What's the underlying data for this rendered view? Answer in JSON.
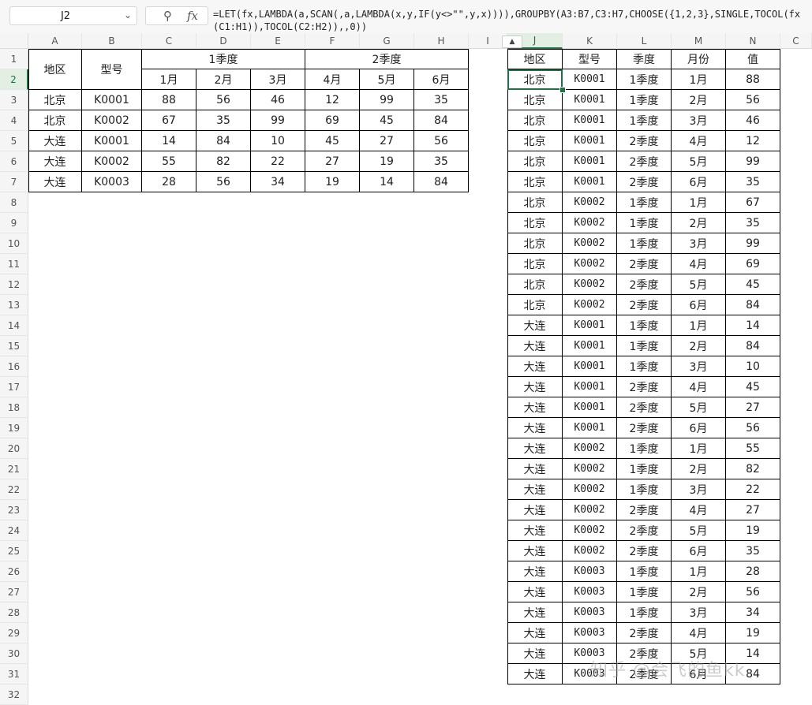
{
  "formula_bar": {
    "name_box": "J2",
    "formula": "=LET(fx,LAMBDA(a,SCAN(,a,LAMBDA(x,y,IF(y<>\"\",y,x)))),GROUPBY(A3:B7,C3:H7,CHOOSE({1,2,3},SINGLE,TOCOL(fx(C1:H1)),TOCOL(C2:H2)),,0))"
  },
  "columns": [
    "A",
    "B",
    "C",
    "D",
    "E",
    "F",
    "G",
    "H",
    "I",
    "J",
    "K",
    "L",
    "M",
    "N",
    "C"
  ],
  "selected_column": "J",
  "selected_row": "2",
  "rows": [
    "1",
    "2",
    "3",
    "4",
    "5",
    "6",
    "7",
    "8",
    "9",
    "10",
    "11",
    "12",
    "13",
    "14",
    "15",
    "16",
    "17",
    "18",
    "19",
    "20",
    "21",
    "22",
    "23",
    "24",
    "25",
    "26",
    "27",
    "28",
    "29",
    "30",
    "31",
    "32"
  ],
  "source": {
    "h_region": "地区",
    "h_model": "型号",
    "h_q1": "1季度",
    "h_q2": "2季度",
    "months": [
      "1月",
      "2月",
      "3月",
      "4月",
      "5月",
      "6月"
    ],
    "rows": [
      [
        "北京",
        "K0001",
        "88",
        "56",
        "46",
        "12",
        "99",
        "35"
      ],
      [
        "北京",
        "K0002",
        "67",
        "35",
        "99",
        "69",
        "45",
        "84"
      ],
      [
        "大连",
        "K0001",
        "14",
        "84",
        "10",
        "45",
        "27",
        "56"
      ],
      [
        "大连",
        "K0002",
        "55",
        "82",
        "22",
        "27",
        "19",
        "35"
      ],
      [
        "大连",
        "K0003",
        "28",
        "56",
        "34",
        "19",
        "14",
        "84"
      ]
    ]
  },
  "output": {
    "headers": [
      "地区",
      "型号",
      "季度",
      "月份",
      "值"
    ],
    "rows": [
      [
        "北京",
        "K0001",
        "1季度",
        "1月",
        "88"
      ],
      [
        "北京",
        "K0001",
        "1季度",
        "2月",
        "56"
      ],
      [
        "北京",
        "K0001",
        "1季度",
        "3月",
        "46"
      ],
      [
        "北京",
        "K0001",
        "2季度",
        "4月",
        "12"
      ],
      [
        "北京",
        "K0001",
        "2季度",
        "5月",
        "99"
      ],
      [
        "北京",
        "K0001",
        "2季度",
        "6月",
        "35"
      ],
      [
        "北京",
        "K0002",
        "1季度",
        "1月",
        "67"
      ],
      [
        "北京",
        "K0002",
        "1季度",
        "2月",
        "35"
      ],
      [
        "北京",
        "K0002",
        "1季度",
        "3月",
        "99"
      ],
      [
        "北京",
        "K0002",
        "2季度",
        "4月",
        "69"
      ],
      [
        "北京",
        "K0002",
        "2季度",
        "5月",
        "45"
      ],
      [
        "北京",
        "K0002",
        "2季度",
        "6月",
        "84"
      ],
      [
        "大连",
        "K0001",
        "1季度",
        "1月",
        "14"
      ],
      [
        "大连",
        "K0001",
        "1季度",
        "2月",
        "84"
      ],
      [
        "大连",
        "K0001",
        "1季度",
        "3月",
        "10"
      ],
      [
        "大连",
        "K0001",
        "2季度",
        "4月",
        "45"
      ],
      [
        "大连",
        "K0001",
        "2季度",
        "5月",
        "27"
      ],
      [
        "大连",
        "K0001",
        "2季度",
        "6月",
        "56"
      ],
      [
        "大连",
        "K0002",
        "1季度",
        "1月",
        "55"
      ],
      [
        "大连",
        "K0002",
        "1季度",
        "2月",
        "82"
      ],
      [
        "大连",
        "K0002",
        "1季度",
        "3月",
        "22"
      ],
      [
        "大连",
        "K0002",
        "2季度",
        "4月",
        "27"
      ],
      [
        "大连",
        "K0002",
        "2季度",
        "5月",
        "19"
      ],
      [
        "大连",
        "K0002",
        "2季度",
        "6月",
        "35"
      ],
      [
        "大连",
        "K0003",
        "1季度",
        "1月",
        "28"
      ],
      [
        "大连",
        "K0003",
        "1季度",
        "2月",
        "56"
      ],
      [
        "大连",
        "K0003",
        "1季度",
        "3月",
        "34"
      ],
      [
        "大连",
        "K0003",
        "2季度",
        "4月",
        "19"
      ],
      [
        "大连",
        "K0003",
        "2季度",
        "5月",
        "14"
      ],
      [
        "大连",
        "K0003",
        "2季度",
        "6月",
        "84"
      ]
    ]
  },
  "watermark": "知乎 @会飞的鱼kk",
  "icons": {
    "name_box_dropdown": "chevron-down-icon",
    "zoom": "zoom-icon",
    "fx": "fx-icon",
    "collapse": "collapse-icon"
  },
  "colors": {
    "accent": "#1e7145",
    "selection_fill": "#e3efe3"
  }
}
